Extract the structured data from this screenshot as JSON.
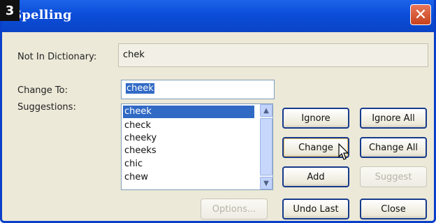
{
  "step_badge": "3",
  "window": {
    "title": "Spelling",
    "close_glyph": "✕"
  },
  "not_in_dictionary": {
    "label": "Not In Dictionary:",
    "value": "chek"
  },
  "change_to": {
    "label": "Change To:",
    "value": "cheek"
  },
  "suggestions": {
    "label": "Suggestions:",
    "items": [
      "cheek",
      "check",
      "cheeky",
      "cheeks",
      "chic",
      "chew"
    ],
    "selected_index": 0
  },
  "buttons": {
    "ignore": "Ignore",
    "ignore_all": "Ignore All",
    "change": "Change",
    "change_all": "Change All",
    "add": "Add",
    "suggest": "Suggest",
    "options": "Options...",
    "undo_last": "Undo Last",
    "close": "Close"
  },
  "icons": {
    "close": "close-icon",
    "scroll_up": "chevron-up-icon",
    "scroll_down": "chevron-down-icon",
    "pointer": "mouse-pointer-icon"
  },
  "colors": {
    "titlebar": "#0b4dd8",
    "selection": "#316ac5",
    "dialog_bg": "#ece9d8",
    "close_button": "#c8421c"
  }
}
